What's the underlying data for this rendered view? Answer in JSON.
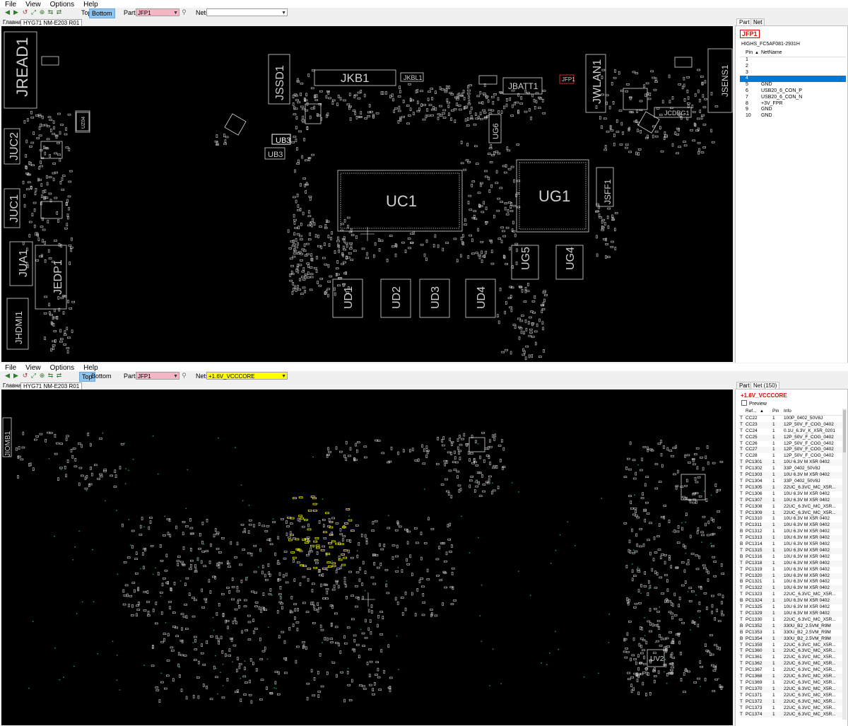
{
  "menu": [
    "File",
    "View",
    "Options",
    "Help"
  ],
  "w1": {
    "side_labels": {
      "top": "Top",
      "bottom": "Bottom"
    },
    "parts_label": "Parts:",
    "parts_value": "JFP1",
    "nets_label": "Nets:",
    "nets_value": "",
    "tabs": [
      "Главная",
      "HYG71 NM-E203 R01"
    ],
    "side_tabs": [
      "Part",
      "Net"
    ],
    "part": {
      "ref": "JFP1",
      "name": "HIGHS_FC5AF081-2931H",
      "headers": [
        "Pin",
        "NetName"
      ],
      "pins": [
        {
          "pin": "1",
          "net": ""
        },
        {
          "pin": "2",
          "net": ""
        },
        {
          "pin": "3",
          "net": ""
        },
        {
          "pin": "4",
          "net": ""
        },
        {
          "pin": "5",
          "net": "GND"
        },
        {
          "pin": "6",
          "net": "USB20_6_CON_P"
        },
        {
          "pin": "7",
          "net": "USB20_6_CON_N"
        },
        {
          "pin": "8",
          "net": "+3V_FPR"
        },
        {
          "pin": "9",
          "net": "GND"
        },
        {
          "pin": "10",
          "net": "GND"
        }
      ]
    },
    "labels": {
      "jread1": "JREAD1",
      "jssd1": "JSSD1",
      "jkb1": "JKB1",
      "jkbl1": "JKBL1",
      "jfp1": "JFP1",
      "jbatt1": "JBATT1",
      "jwlan1": "JWLAN1",
      "jsens1": "JSENS1",
      "ub3a": "UB3",
      "ub3b": "UB3",
      "uc1": "UC1",
      "ug1": "UG1",
      "ug6": "UG6",
      "juc2": "JUC2",
      "juc1": "JUC1",
      "jua1": "JUA1",
      "jedp1": "JEDP1",
      "jhdmi1": "JHDMI1",
      "jsff1": "JSFF1",
      "ug5": "UG5",
      "ug4": "UG4",
      "ud1": "UD1",
      "ud2": "UD2",
      "ud3": "UD3",
      "ud4": "UD4",
      "jcdbg1": "JCDBG1",
      "uz04": "UZ04"
    }
  },
  "w2": {
    "side_labels": {
      "top": "Top",
      "bottom": "Bottom"
    },
    "parts_label": "Parts:",
    "parts_value": "JFP1",
    "nets_label": "Nets:",
    "nets_value": "+1.6V_VCCCORE",
    "tabs": [
      "Главная",
      "HYG71 NM-E203 R01"
    ],
    "side_tabs": [
      "Part",
      "Net (150)"
    ],
    "net": {
      "title": "+1.6V_VCCCORE",
      "preview": "Preview",
      "headers": [
        "Ref...",
        "Pin",
        "Info"
      ],
      "rows": [
        [
          "T",
          "CC22",
          "1",
          "100P_0402_50V8J"
        ],
        [
          "T",
          "CC23",
          "1",
          "12P_50V_F_COG_0402"
        ],
        [
          "T",
          "CC24",
          "1",
          "0.1U_6.3V_K_X5R_0201"
        ],
        [
          "T",
          "CC25",
          "1",
          "12P_50V_F_COG_0402"
        ],
        [
          "T",
          "CC26",
          "1",
          "12P_50V_F_COG_0402"
        ],
        [
          "T",
          "CC27",
          "1",
          "12P_50V_F_COG_0402"
        ],
        [
          "T",
          "CC28",
          "1",
          "12P_50V_F_COG_0402"
        ],
        [
          "T",
          "PC1301",
          "1",
          "10U 6.3V M X5R 0402"
        ],
        [
          "T",
          "PC1302",
          "1",
          "33P_0402_50V8J"
        ],
        [
          "T",
          "PC1303",
          "1",
          "10U 6.3V M X5R 0402"
        ],
        [
          "T",
          "PC1304",
          "1",
          "33P_0402_50V8J"
        ],
        [
          "T",
          "PC1305",
          "1",
          "22UC_6.3VC_MC_X5R..."
        ],
        [
          "T",
          "PC1306",
          "1",
          "10U 6.3V M X5R 0402"
        ],
        [
          "T",
          "PC1307",
          "1",
          "10U 6.3V M X5R 0402"
        ],
        [
          "T",
          "PC1308",
          "1",
          "22UC_6.3VC_MC_X5R..."
        ],
        [
          "T",
          "PC1309",
          "1",
          "22UC_6.3VC_MC_X5R..."
        ],
        [
          "T",
          "PC1310",
          "1",
          "10U 6.3V M X5R 0402"
        ],
        [
          "T",
          "PC1311",
          "1",
          "10U 6.3V M X5R 0402"
        ],
        [
          "B",
          "PC1312",
          "1",
          "10U 6.3V M X5R 0402"
        ],
        [
          "T",
          "PC1313",
          "1",
          "10U 6.3V M X5R 0402"
        ],
        [
          "B",
          "PC1314",
          "1",
          "10U 6.3V M X5R 0402"
        ],
        [
          "T",
          "PC1315",
          "1",
          "10U 6.3V M X5R 0402"
        ],
        [
          "B",
          "PC1316",
          "1",
          "10U 6.3V M X5R 0402"
        ],
        [
          "T",
          "PC1318",
          "1",
          "10U 6.3V M X5R 0402"
        ],
        [
          "T",
          "PC1319",
          "1",
          "10U 6.3V M X5R 0402"
        ],
        [
          "T",
          "PC1320",
          "1",
          "10U 6.3V M X5R 0402"
        ],
        [
          "B",
          "PC1321",
          "1",
          "10U 6.3V M X5R 0402"
        ],
        [
          "T",
          "PC1322",
          "1",
          "10U 6.3V M X5R 0402"
        ],
        [
          "T",
          "PC1323",
          "1",
          "22UC_6.3VC_MC_X5R..."
        ],
        [
          "B",
          "PC1324",
          "1",
          "10U 6.3V M X5R 0402"
        ],
        [
          "T",
          "PC1325",
          "1",
          "10U 6.3V M X5R 0402"
        ],
        [
          "T",
          "PC1329",
          "1",
          "10U 6.3V M X5R 0402"
        ],
        [
          "T",
          "PC1330",
          "1",
          "22UC_6.3VC_MC_X5R..."
        ],
        [
          "B",
          "PC1352",
          "1",
          "330U_B2_2.5VM_R9M"
        ],
        [
          "B",
          "PC1353",
          "1",
          "330U_B2_2.5VM_R9M"
        ],
        [
          "B",
          "PC1354",
          "1",
          "330U_B2_2.5VM_R9M"
        ],
        [
          "T",
          "PC1359",
          "1",
          "22UC_6.3VC_MC_X5R..."
        ],
        [
          "T",
          "PC1360",
          "1",
          "22UC_6.3VC_MC_X5R..."
        ],
        [
          "T",
          "PC1361",
          "1",
          "22UC_6.3VC_MC_X5R..."
        ],
        [
          "T",
          "PC1362",
          "1",
          "22UC_6.3VC_MC_X5R..."
        ],
        [
          "T",
          "PC1367",
          "1",
          "22UC_6.3VC_MC_X5R..."
        ],
        [
          "T",
          "PC1368",
          "1",
          "22UC_6.3VC_MC_X5R..."
        ],
        [
          "T",
          "PC1369",
          "1",
          "22UC_6.3VC_MC_X5R..."
        ],
        [
          "T",
          "PC1370",
          "1",
          "22UC_6.3VC_MC_X5R..."
        ],
        [
          "T",
          "PC1371",
          "1",
          "22UC_6.3VC_MC_X5R..."
        ],
        [
          "T",
          "PC1372",
          "1",
          "22UC_6.3VC_MC_X5R..."
        ],
        [
          "T",
          "PC1373",
          "1",
          "22UC_6.3VC_MC_X5R..."
        ],
        [
          "T",
          "PC1374",
          "1",
          "22UC_6.3VC_MC_X5R..."
        ]
      ]
    },
    "labels": {
      "jiomb1": "JIOMB1",
      "uv2": "UV2"
    }
  },
  "colors": {
    "canvas": "#000000",
    "outline": "#e0e0e0",
    "highlight": "#ffff00",
    "dots": "#1a8a6a",
    "selected": "#0078d7",
    "part_ref": "#ee0000"
  }
}
